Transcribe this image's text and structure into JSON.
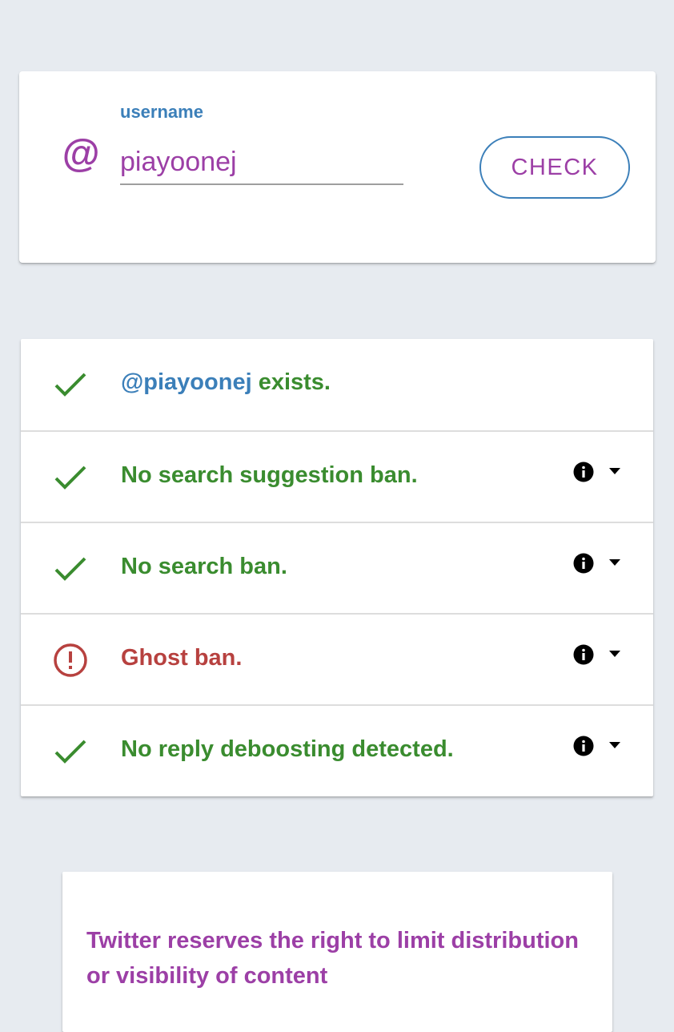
{
  "search": {
    "at_symbol": "@",
    "label": "username",
    "value": "piayoonej",
    "check_label": "CHECK"
  },
  "results": [
    {
      "handle": "@piayoonej",
      "text": " exists.",
      "status": "ok",
      "icon": "check-icon"
    },
    {
      "text": "No search suggestion ban.",
      "status": "ok",
      "icon": "check-icon",
      "info_icon": "info-icon",
      "dropdown_icon": "dropdown-arrow-icon"
    },
    {
      "text": "No search ban.",
      "status": "ok",
      "icon": "check-icon",
      "info_icon": "info-icon",
      "dropdown_icon": "dropdown-arrow-icon"
    },
    {
      "text": "Ghost ban.",
      "status": "warning",
      "icon": "alert-circle-icon",
      "info_icon": "info-icon",
      "dropdown_icon": "dropdown-arrow-icon"
    },
    {
      "text": "No reply deboosting detected.",
      "status": "ok",
      "icon": "check-icon",
      "info_icon": "info-icon",
      "dropdown_icon": "dropdown-arrow-icon"
    }
  ],
  "notice": {
    "text": "Twitter reserves the right to limit distribution or visibility of content"
  },
  "colors": {
    "background": "#e7ebf0",
    "accent_purple": "#9c3fa6",
    "accent_blue": "#3b7fb9",
    "ok_green": "#3a8c2f",
    "warning_red": "#b7413f"
  }
}
